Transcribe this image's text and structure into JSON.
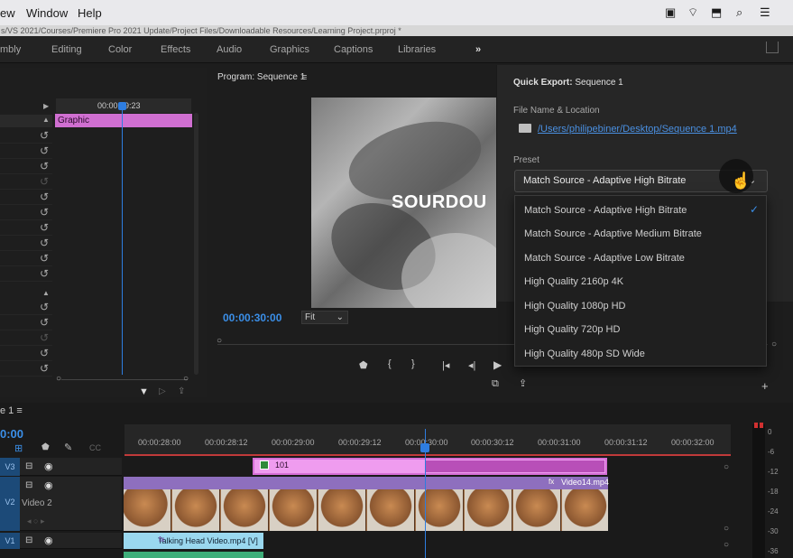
{
  "menubar": {
    "items": [
      "ew",
      "Window",
      "Help"
    ],
    "tray": [
      "▣",
      "⌔",
      "⬒",
      "⌕",
      "☰"
    ]
  },
  "pathbar": {
    "path": "s/VS 2021/Courses/Premiere Pro 2021 Update/Project Files/Downloadable Resources/Learning Project.prproj *"
  },
  "workspaces": {
    "items": [
      "mbly",
      "Editing",
      "Color",
      "Effects",
      "Audio",
      "Graphics",
      "Captions",
      "Libraries"
    ],
    "more": "»"
  },
  "left_panel": {
    "timecode": "00:00:29:23",
    "graphic_clip": "Graphic"
  },
  "program": {
    "title": "Program: Sequence 1",
    "menu_icon": "≡",
    "overlay_text": "SOURDOU",
    "timecode": "00:00:30:00",
    "fit": "Fit"
  },
  "quick_export": {
    "title_bold": "Quick Export:",
    "title_rest": "Sequence 1",
    "file_label": "File Name & Location",
    "file_path": "/Users/philipebiner/Desktop/Sequence 1.mp4",
    "preset_label": "Preset",
    "selected": "Match Source - Adaptive High Bitrate",
    "options": [
      "Match Source - Adaptive High Bitrate",
      "Match Source - Adaptive Medium Bitrate",
      "Match Source - Adaptive Low Bitrate",
      "High Quality 2160p 4K",
      "High Quality 1080p HD",
      "High Quality 720p HD",
      "High Quality 480p SD Wide"
    ],
    "check": "✓"
  },
  "timeline": {
    "tab": "e 1 ≡",
    "timecode": "0:00",
    "ticks": [
      "00:00:28:00",
      "00:00:28:12",
      "00:00:29:00",
      "00:00:29:12",
      "00:00:30:00",
      "00:00:30:12",
      "00:00:31:00",
      "00:00:31:12",
      "00:00:32:00"
    ],
    "tracks": {
      "v3": "V3",
      "v2": "V2",
      "v1": "V1",
      "v2_name": "Video 2"
    },
    "clip_101": "101",
    "clip_video14": "Video14.mp4",
    "clip_talking": "Talking Head Video.mp4 [V]",
    "meter_labels": [
      "0",
      "-6",
      "-12",
      "-18",
      "-24",
      "-30",
      "-36"
    ]
  },
  "colors": {
    "accent": "#2e7de0",
    "graphic_clip": "#d06fd1",
    "video_clip": "#9ad8ef"
  }
}
